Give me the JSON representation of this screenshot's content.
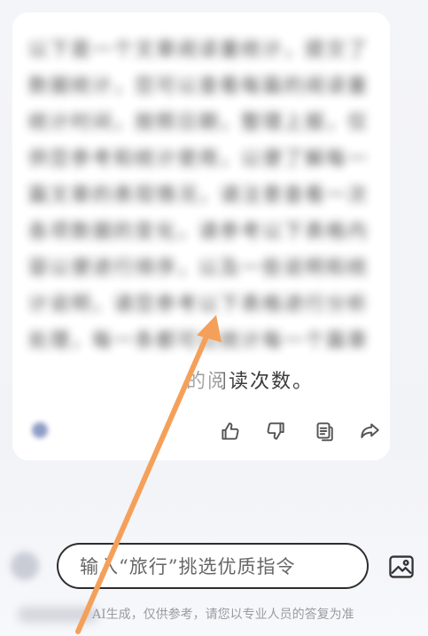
{
  "message": {
    "blurred_lines": [
      "以下是一个文章阅读量统计，提交了",
      "数据统计，您可以查看每篇的阅读量",
      "统计时间，按照日期，整理上报，仅",
      "供您参考和统计使用，以便了解每一",
      "篇文章的表现情况，请注意查看一次",
      "各项数据的变化，请参考以下表格内",
      "容以便进行排序，以及一些说明和统",
      "计说明，请您参考以下表格进行分析",
      "处理，每一条都可以统计每一个篇章"
    ],
    "visible_tail": "的阅读次数。"
  },
  "actions": {
    "like": "thumbs-up-icon",
    "dislike": "thumbs-down-icon",
    "copy": "copy-icon",
    "share": "share-icon"
  },
  "input": {
    "placeholder": "输入“旅行”挑选优质指令"
  },
  "disclaimer": "AI生成，仅供参考，请您以专业人员的答复为准",
  "colors": {
    "arrow": "#f5a05a",
    "input_border": "#2d2d2d",
    "disclaimer_text": "#999ba3"
  }
}
